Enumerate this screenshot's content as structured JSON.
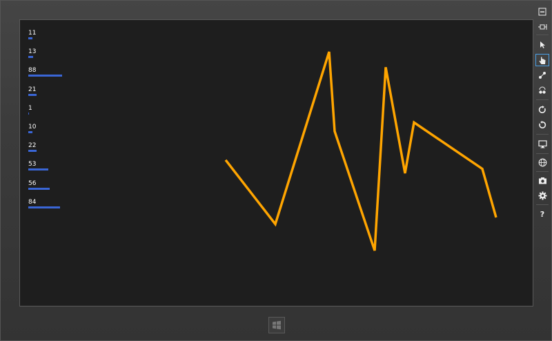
{
  "list": {
    "items": [
      {
        "label": "11",
        "value": 11
      },
      {
        "label": "13",
        "value": 13
      },
      {
        "label": "88",
        "value": 88
      },
      {
        "label": "21",
        "value": 21
      },
      {
        "label": "1",
        "value": 1
      },
      {
        "label": "10",
        "value": 10
      },
      {
        "label": "22",
        "value": 22
      },
      {
        "label": "53",
        "value": 53
      },
      {
        "label": "56",
        "value": 56
      },
      {
        "label": "84",
        "value": 84
      }
    ],
    "bar_color": "#3a66d6"
  },
  "chart_data": {
    "type": "line",
    "series": [
      {
        "values": [
          46,
          17,
          95,
          59,
          5,
          88,
          40,
          63,
          42,
          20
        ]
      }
    ],
    "ylim": [
      0,
      100
    ],
    "color": "#ffa500"
  },
  "toolbar": {
    "icons": [
      "minimize-icon",
      "pin-icon",
      "pointer-icon",
      "touch-icon",
      "pinch-zoom-icon",
      "rotate-touch-icon",
      "rotate-clockwise-icon",
      "rotate-counterclockwise-icon",
      "resolution-icon",
      "location-icon",
      "screenshot-icon",
      "settings-icon",
      "help-icon"
    ],
    "help_label": "?"
  }
}
